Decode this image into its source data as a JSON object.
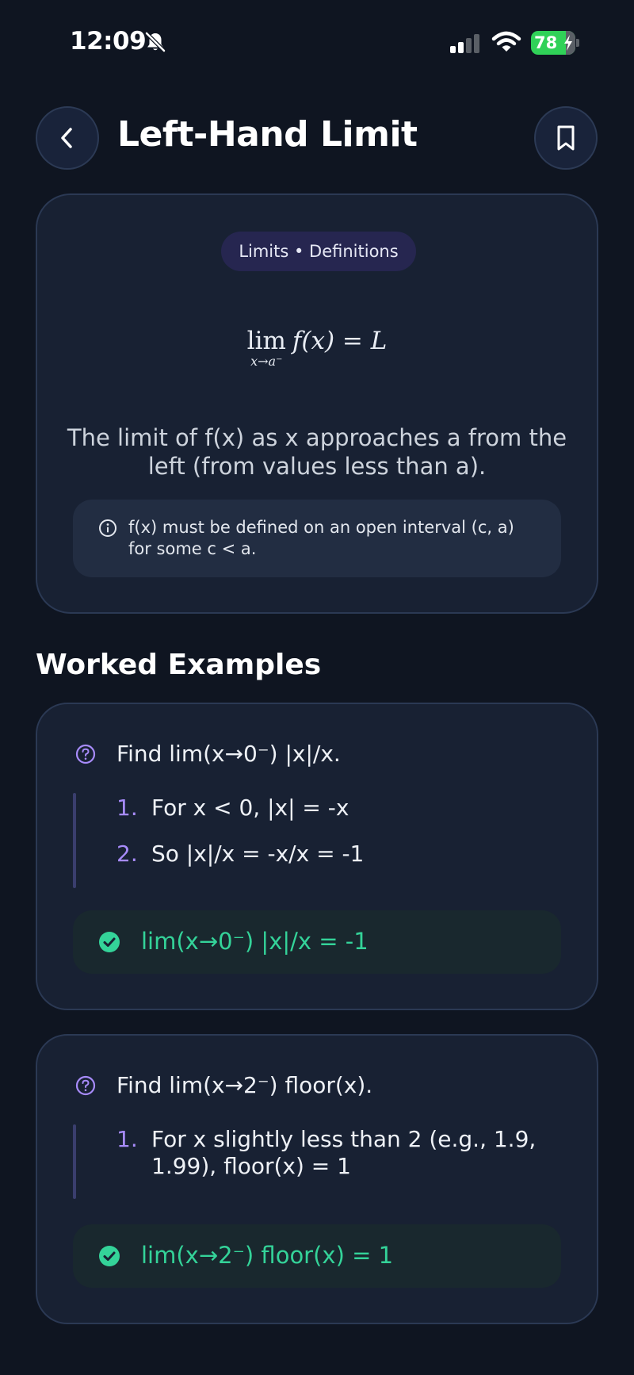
{
  "status_bar": {
    "time": "12:09",
    "battery": "78",
    "icons": [
      "bell-slash-icon",
      "signal-icon",
      "wifi-icon",
      "battery-charging-icon"
    ]
  },
  "header": {
    "title": "Left-Hand Limit",
    "back_icon": "chevron-left-icon",
    "bookmark_icon": "bookmark-icon"
  },
  "definition": {
    "tag": "Limits • Definitions",
    "formula": {
      "operator": "lim",
      "subscript": "x→a⁻",
      "expression": "f(x) = L"
    },
    "text": "The limit of f(x) as x approaches a from the left (from values less than a).",
    "note": "f(x) must be defined on an open interval (c, a) for some c < a.",
    "note_icon": "info-icon"
  },
  "section": {
    "title": "Worked Examples"
  },
  "examples": [
    {
      "question": "Find lim(x→0⁻) |x|/x.",
      "steps": [
        {
          "num": "1.",
          "text": "For x < 0, |x| = -x"
        },
        {
          "num": "2.",
          "text": "So |x|/x = -x/x = -1"
        }
      ],
      "answer": "lim(x→0⁻) |x|/x = -1"
    },
    {
      "question": "Find lim(x→2⁻) floor(x).",
      "steps": [
        {
          "num": "1.",
          "text": "For x slightly less than 2 (e.g., 1.9, 1.99), floor(x) = 1"
        }
      ],
      "answer": "lim(x→2⁻) floor(x) = 1"
    }
  ],
  "colors": {
    "background": "#0f1521",
    "card": "#182133",
    "accent_purple": "#a78bfa",
    "answer_green": "#34d399",
    "battery_green": "#30d158"
  }
}
